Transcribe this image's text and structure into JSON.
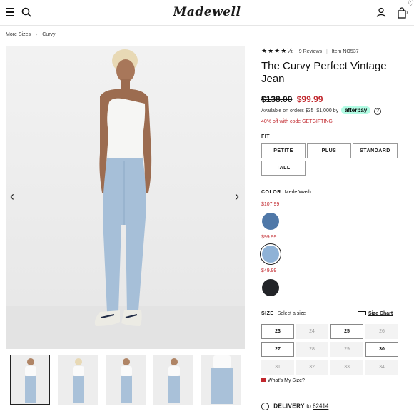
{
  "header": {
    "logo": "Madewell",
    "bag_count": "0",
    "corner_glyph": "♡"
  },
  "breadcrumb": [
    "More Sizes",
    "Curvy"
  ],
  "product": {
    "stars": "★★★★½",
    "reviews": "9 Reviews",
    "item": "Item NO537",
    "title": "The Curvy Perfect Vintage Jean",
    "price_old": "$138.00",
    "price_new": "$99.99",
    "afterpay_text": "Available on orders $35–$1,000 by",
    "afterpay_brand": "afterpay",
    "afterpay_info": "?",
    "promo": "40% off with code GETGIFTING"
  },
  "fit": {
    "label": "FIT",
    "options": [
      "PETITE",
      "PLUS",
      "STANDARD",
      "TALL"
    ]
  },
  "color": {
    "label": "COLOR",
    "selected": "Merle Wash",
    "swatches": [
      {
        "price": "$107.99",
        "color": "#4f78a8"
      },
      {
        "price": "$99.99",
        "color": "#8fb2d6"
      },
      {
        "price": "$49.99",
        "color": "#222428"
      }
    ]
  },
  "size": {
    "label": "SIZE",
    "prompt": "Select a size",
    "chart_label": "Size Chart",
    "rows": [
      [
        {
          "v": "23",
          "a": true
        },
        {
          "v": "24",
          "a": false
        },
        {
          "v": "25",
          "a": true
        },
        {
          "v": "26",
          "a": false
        }
      ],
      [
        {
          "v": "27",
          "a": true
        },
        {
          "v": "28",
          "a": false
        },
        {
          "v": "29",
          "a": false
        },
        {
          "v": "30",
          "a": true
        }
      ],
      [
        {
          "v": "31",
          "a": false
        },
        {
          "v": "32",
          "a": false
        },
        {
          "v": "33",
          "a": false
        },
        {
          "v": "34",
          "a": false
        }
      ]
    ],
    "whats_my_size": "What's My Size?"
  },
  "delivery": {
    "label": "DELIVERY",
    "to": "to",
    "zip": "82414"
  },
  "gallery": {
    "prev": "‹",
    "next": "›"
  },
  "colors": {
    "sale": "#c1272d",
    "afterpay": "#b2fce4"
  }
}
